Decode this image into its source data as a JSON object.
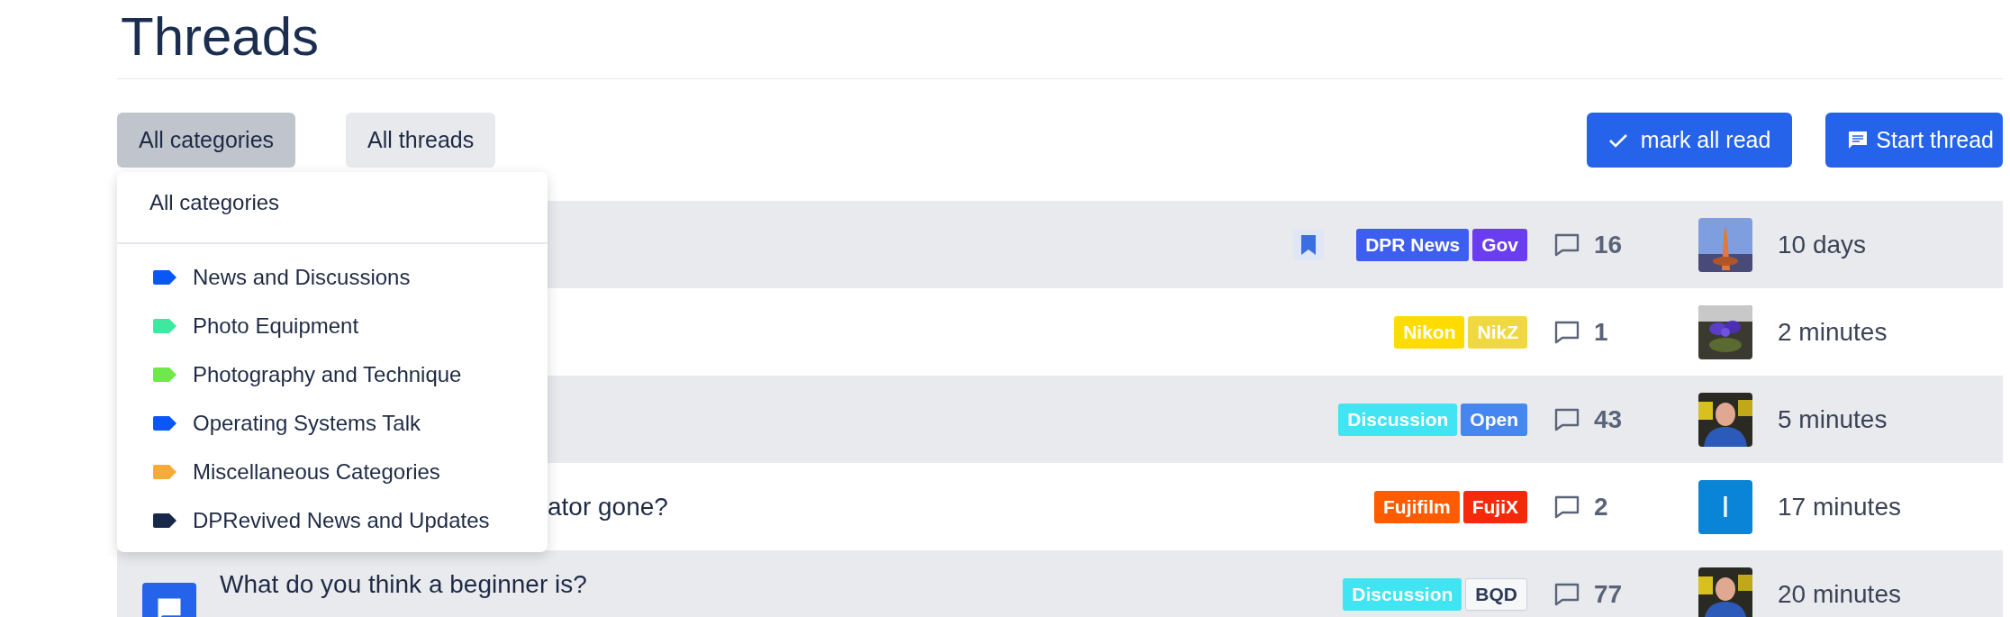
{
  "page_title": "Threads",
  "filters": [
    {
      "label": "All categories",
      "selected": true
    },
    {
      "label": "All threads",
      "selected": false
    }
  ],
  "actions": [
    {
      "kind": "check",
      "label": "mark all read"
    },
    {
      "kind": "chat",
      "label": "Start thread"
    }
  ],
  "category_menu": {
    "header": "All categories",
    "items": [
      {
        "label": "News and Discussions",
        "color": "#0b57f5"
      },
      {
        "label": "Photo Equipment",
        "color": "#3ee8a0"
      },
      {
        "label": "Photography and Technique",
        "color": "#6ee84a"
      },
      {
        "label": "Operating Systems Talk",
        "color": "#0b57f5"
      },
      {
        "label": "Miscellaneous Categories",
        "color": "#f5ac3a"
      },
      {
        "label": "DPRevived News and Updates",
        "color": "#16294a"
      }
    ]
  },
  "rows": [
    {
      "bookmarked": true,
      "tags": [
        {
          "label": "DPR News",
          "color": "#3d5ef0"
        },
        {
          "label": "Gov",
          "color": "#6a3df0"
        }
      ],
      "replies": "16",
      "time": "10 days"
    },
    {
      "bookmarked": false,
      "tags": [
        {
          "label": "Nikon",
          "color": "#ffdc00"
        },
        {
          "label": "NikZ",
          "color": "#f0d840"
        }
      ],
      "replies": "1",
      "time": "2 minutes"
    },
    {
      "bookmarked": false,
      "tags": [
        {
          "label": "Discussion",
          "color": "#40e4f2"
        },
        {
          "label": "Open",
          "color": "#4586f0"
        }
      ],
      "replies": "43",
      "time": "5 minutes"
    },
    {
      "bookmarked": false,
      "title": "ator gone?",
      "title_cut": true,
      "tags": [
        {
          "label": "Fujifilm",
          "color": "#ff5c00"
        },
        {
          "label": "FujiX",
          "color": "#f52a0a"
        }
      ],
      "replies": "2",
      "avatar": {
        "kind": "letter",
        "letter": "I",
        "color": "#0a84d6"
      },
      "time": "17 minutes"
    },
    {
      "bookmarked": false,
      "title": "What do you think a beginner is?",
      "tags": [
        {
          "label": "Discussion",
          "color": "#40e4f2"
        },
        {
          "label": "BQD",
          "color": "#f6f7f9"
        }
      ],
      "replies": "77",
      "time": "20 minutes"
    }
  ]
}
